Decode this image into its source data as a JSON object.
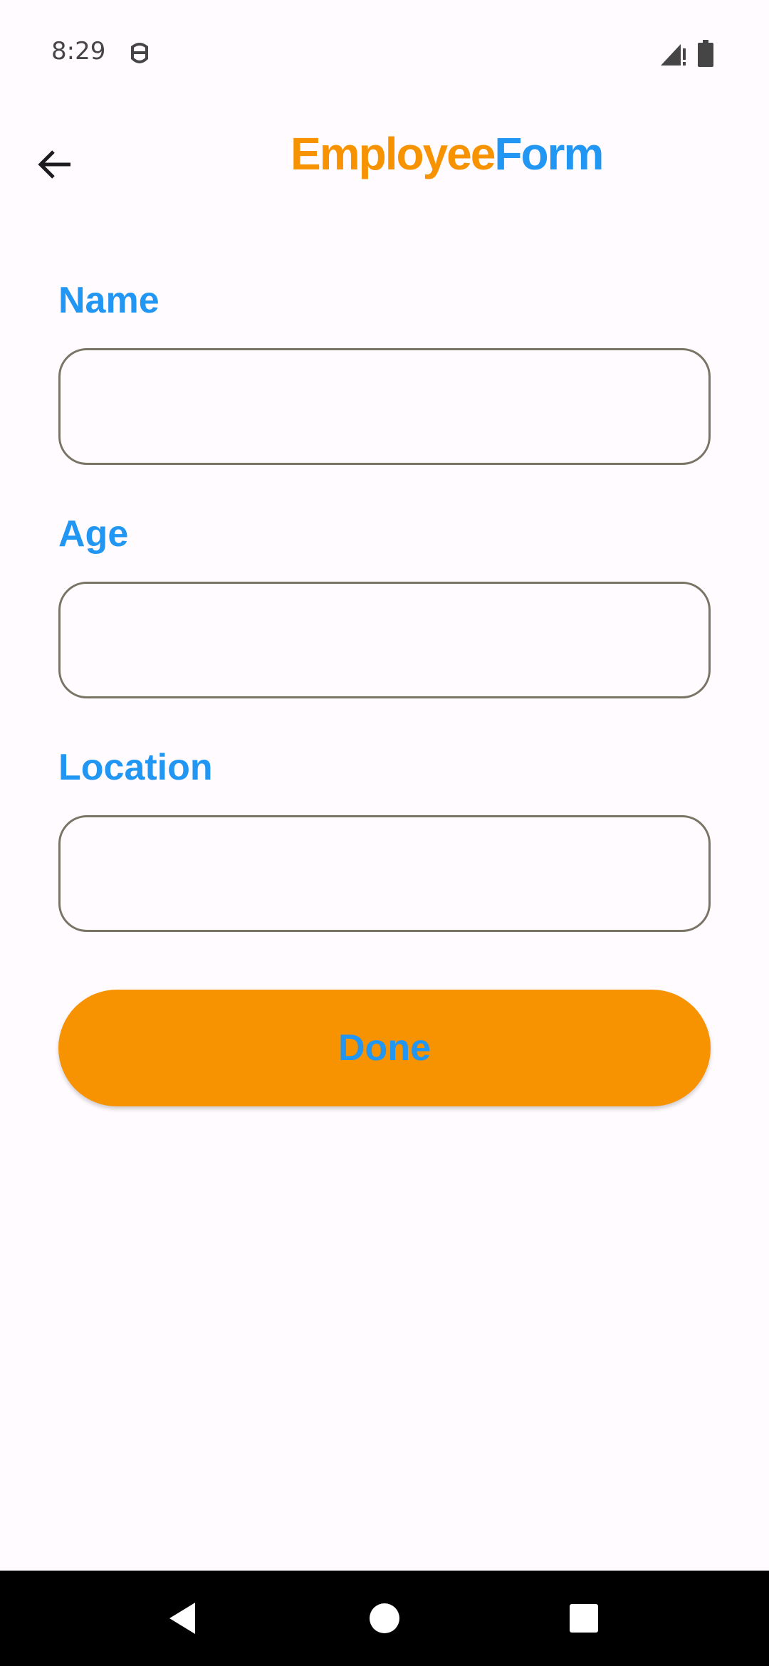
{
  "status_bar": {
    "time": "8:29",
    "icons": [
      "robot-icon",
      "signal-icon",
      "battery-icon"
    ]
  },
  "app_bar": {
    "title_part1": "Employee",
    "title_part2": "Form",
    "back_icon": "arrow-left-icon"
  },
  "form": {
    "fields": [
      {
        "label": "Name",
        "value": "",
        "placeholder": ""
      },
      {
        "label": "Age",
        "value": "",
        "placeholder": ""
      },
      {
        "label": "Location",
        "value": "",
        "placeholder": ""
      }
    ],
    "done_label": "Done"
  },
  "nav_bar": {
    "icons": [
      "back-triangle-icon",
      "home-circle-icon",
      "recents-square-icon"
    ]
  },
  "colors": {
    "accent_orange": "#f79200",
    "accent_blue": "#2196f3",
    "background": "#fffbfe",
    "outline": "#7a7467"
  }
}
